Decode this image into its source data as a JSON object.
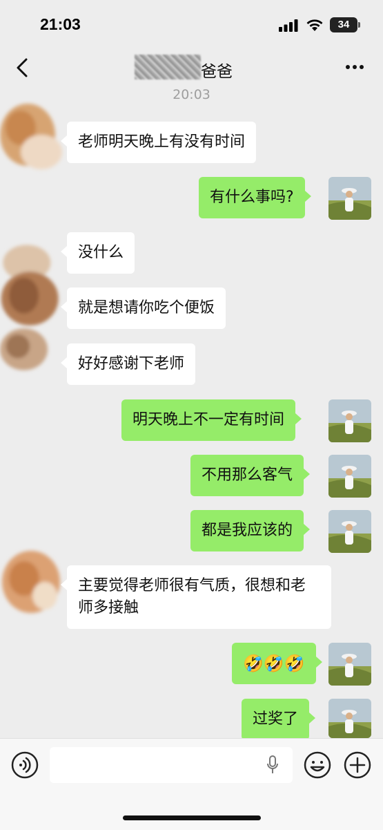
{
  "status_bar": {
    "time": "21:03",
    "battery": "34"
  },
  "header": {
    "contact_name": "爸爸",
    "back_icon": "chevron-left-icon",
    "more_icon": "more-dots-icon"
  },
  "chat": {
    "timestamp": "20:03",
    "messages": [
      {
        "side": "left",
        "text": "老师明天晚上有没有时间"
      },
      {
        "side": "right",
        "text": "有什么事吗?"
      },
      {
        "side": "left",
        "text": "没什么"
      },
      {
        "side": "left",
        "text": "就是想请你吃个便饭"
      },
      {
        "side": "left",
        "text": "好好感谢下老师"
      },
      {
        "side": "right",
        "text": "明天晚上不一定有时间"
      },
      {
        "side": "right",
        "text": "不用那么客气"
      },
      {
        "side": "right",
        "text": "都是我应该的"
      },
      {
        "side": "left",
        "text": "主要觉得老师很有气质，很想和老师多接触"
      },
      {
        "side": "right",
        "text": "🤣🤣🤣"
      },
      {
        "side": "right",
        "text": "过奖了"
      }
    ]
  },
  "input_bar": {
    "placeholder": "",
    "icons": [
      "voice-icon",
      "mic-icon",
      "emoji-icon",
      "plus-icon"
    ]
  },
  "colors": {
    "bg": "#ededed",
    "sent_bubble": "#95ec69",
    "received_bubble": "#ffffff"
  }
}
